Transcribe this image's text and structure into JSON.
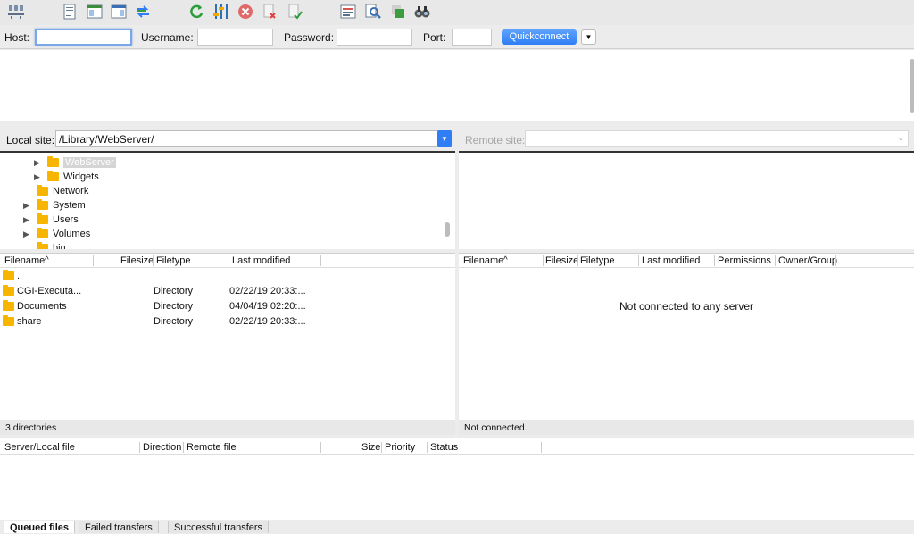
{
  "toolbar": {
    "icons": [
      "site-manager-icon",
      "message-log-icon",
      "local-tree-icon",
      "remote-tree-icon",
      "queue-icon",
      "refresh-icon",
      "process-queue-icon",
      "cancel-icon",
      "disconnect-icon",
      "reconnect-icon",
      "filter-icon",
      "compare-icon",
      "sync-browse-icon",
      "search-icon"
    ]
  },
  "quickconnect": {
    "host_label": "Host:",
    "host_value": "",
    "username_label": "Username:",
    "username_value": "",
    "password_label": "Password:",
    "password_value": "",
    "port_label": "Port:",
    "port_value": "",
    "button_label": "Quickconnect",
    "dropdown_glyph": "▼"
  },
  "local": {
    "site_label": "Local site:",
    "site_path": "/Library/WebServer/",
    "tree": [
      {
        "label": "WebServer",
        "expander": "▶",
        "selected": true
      },
      {
        "label": "Widgets",
        "expander": "▶"
      },
      {
        "label": "Network",
        "expander": ""
      },
      {
        "label": "System",
        "expander": "▶"
      },
      {
        "label": "Users",
        "expander": "▶"
      },
      {
        "label": "Volumes",
        "expander": "▶"
      },
      {
        "label": "bin",
        "expander": ""
      }
    ],
    "columns": {
      "filename": "Filename",
      "filesize": "Filesize",
      "filetype": "Filetype",
      "last_modified": "Last modified",
      "sort_glyph": "^"
    },
    "files": [
      {
        "name": "..",
        "type": "",
        "modified": ""
      },
      {
        "name": "CGI-Executa...",
        "type": "Directory",
        "modified": "02/22/19 20:33:..."
      },
      {
        "name": "Documents",
        "type": "Directory",
        "modified": "04/04/19 02:20:..."
      },
      {
        "name": "share",
        "type": "Directory",
        "modified": "02/22/19 20:33:..."
      }
    ],
    "status": "3 directories"
  },
  "remote": {
    "site_label": "Remote site:",
    "columns": {
      "filename": "Filename",
      "filesize": "Filesize",
      "filetype": "Filetype",
      "last_modified": "Last modified",
      "permissions": "Permissions",
      "owner": "Owner/Group",
      "sort_glyph": "^"
    },
    "empty_message": "Not connected to any server",
    "status": "Not connected."
  },
  "queue": {
    "columns": {
      "server_file": "Server/Local file",
      "direction": "Direction",
      "remote_file": "Remote file",
      "size": "Size",
      "priority": "Priority",
      "status": "Status"
    }
  },
  "tabs": [
    "Queued files",
    "Failed transfers",
    "Successful transfers"
  ],
  "colors": {
    "accent": "#2f7ef5",
    "folder": "#f7b500"
  }
}
